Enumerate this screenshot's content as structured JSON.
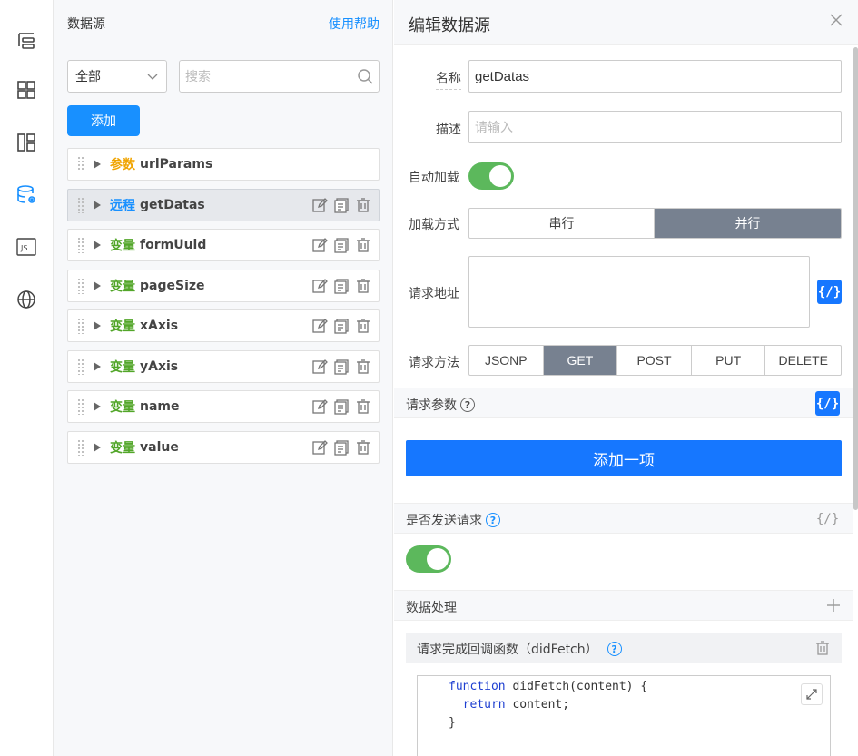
{
  "rail": {
    "icons": [
      "outline-icon",
      "components-icon",
      "layout-icon",
      "datasource-icon",
      "js-icon",
      "globe-icon"
    ],
    "active_color": "#1890ff"
  },
  "datasource_panel": {
    "title": "数据源",
    "help_link": "使用帮助",
    "filter_value": "全部",
    "search_placeholder": "搜索",
    "add_label": "添加",
    "items": [
      {
        "type": "参数",
        "name": "urlParams",
        "kind": "param",
        "active": false,
        "actions": false
      },
      {
        "type": "远程",
        "name": "getDatas",
        "kind": "remote",
        "active": true,
        "actions": true
      },
      {
        "type": "变量",
        "name": "formUuid",
        "kind": "var",
        "active": false,
        "actions": true
      },
      {
        "type": "变量",
        "name": "pageSize",
        "kind": "var",
        "active": false,
        "actions": true
      },
      {
        "type": "变量",
        "name": "xAxis",
        "kind": "var",
        "active": false,
        "actions": true
      },
      {
        "type": "变量",
        "name": "yAxis",
        "kind": "var",
        "active": false,
        "actions": true
      },
      {
        "type": "变量",
        "name": "name",
        "kind": "var",
        "active": false,
        "actions": true
      },
      {
        "type": "变量",
        "name": "value",
        "kind": "var",
        "active": false,
        "actions": true
      }
    ]
  },
  "editor": {
    "title": "编辑数据源",
    "name_label": "名称",
    "name_value": "getDatas",
    "desc_label": "描述",
    "desc_placeholder": "请输入",
    "autoload_label": "自动加载",
    "autoload_on": true,
    "load_mode_label": "加载方式",
    "load_modes": [
      "串行",
      "并行"
    ],
    "load_mode_selected": "并行",
    "url_label": "请求地址",
    "url_value": "",
    "code_toggle": "{/}",
    "method_label": "请求方法",
    "methods": [
      "JSONP",
      "GET",
      "POST",
      "PUT",
      "DELETE"
    ],
    "method_selected": "GET",
    "params_label": "请求参数",
    "add_item_label": "添加一项",
    "send_label": "是否发送请求",
    "send_on": true,
    "data_process_label": "数据处理",
    "did_fetch_label": "请求完成回调函数（didFetch）",
    "code": {
      "line1_kw": "function",
      "line1_rest": " didFetch(content) {",
      "line2_kw": "return",
      "line2_rest": " content;",
      "line3": "}"
    }
  }
}
